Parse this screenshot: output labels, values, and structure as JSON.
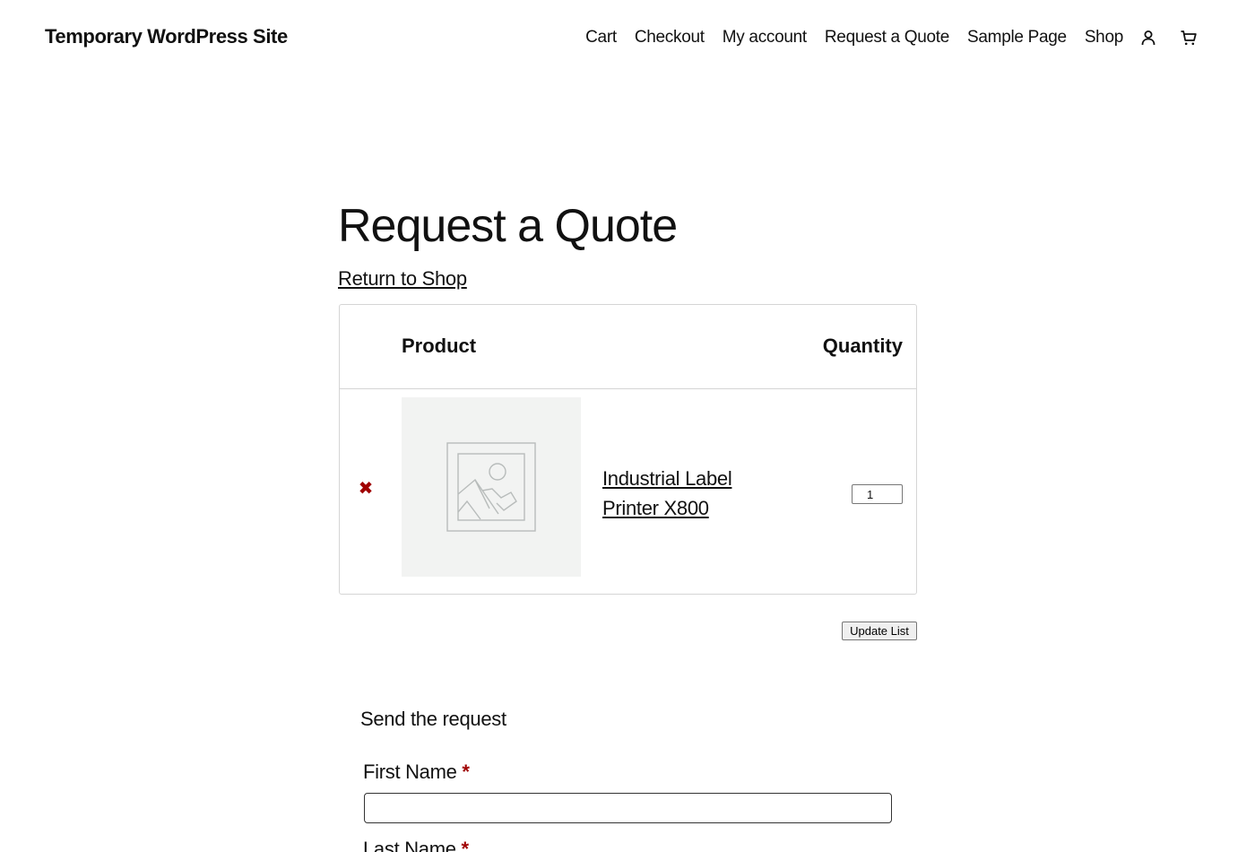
{
  "header": {
    "site_title": "Temporary WordPress Site",
    "nav": [
      "Cart",
      "Checkout",
      "My account",
      "Request a Quote",
      "Sample Page",
      "Shop"
    ],
    "account_icon": "user-icon",
    "cart_icon": "cart-icon"
  },
  "main": {
    "title": "Request a Quote",
    "return_link": "Return to Shop",
    "table": {
      "headers": {
        "product": "Product",
        "quantity": "Quantity"
      },
      "rows": [
        {
          "remove_symbol": "✖",
          "image_icon": "image-placeholder-icon",
          "product": "Industrial Label Printer X800",
          "quantity": "1"
        }
      ]
    },
    "update_button": "Update List"
  },
  "form": {
    "heading": "Send the request",
    "first_name_label": "First Name",
    "last_name_label": "Last Name",
    "required_mark": "*",
    "first_name_value": ""
  },
  "colors": {
    "required": "#a00000",
    "remove": "#a00000",
    "thumb_bg": "#f2f3f2"
  }
}
